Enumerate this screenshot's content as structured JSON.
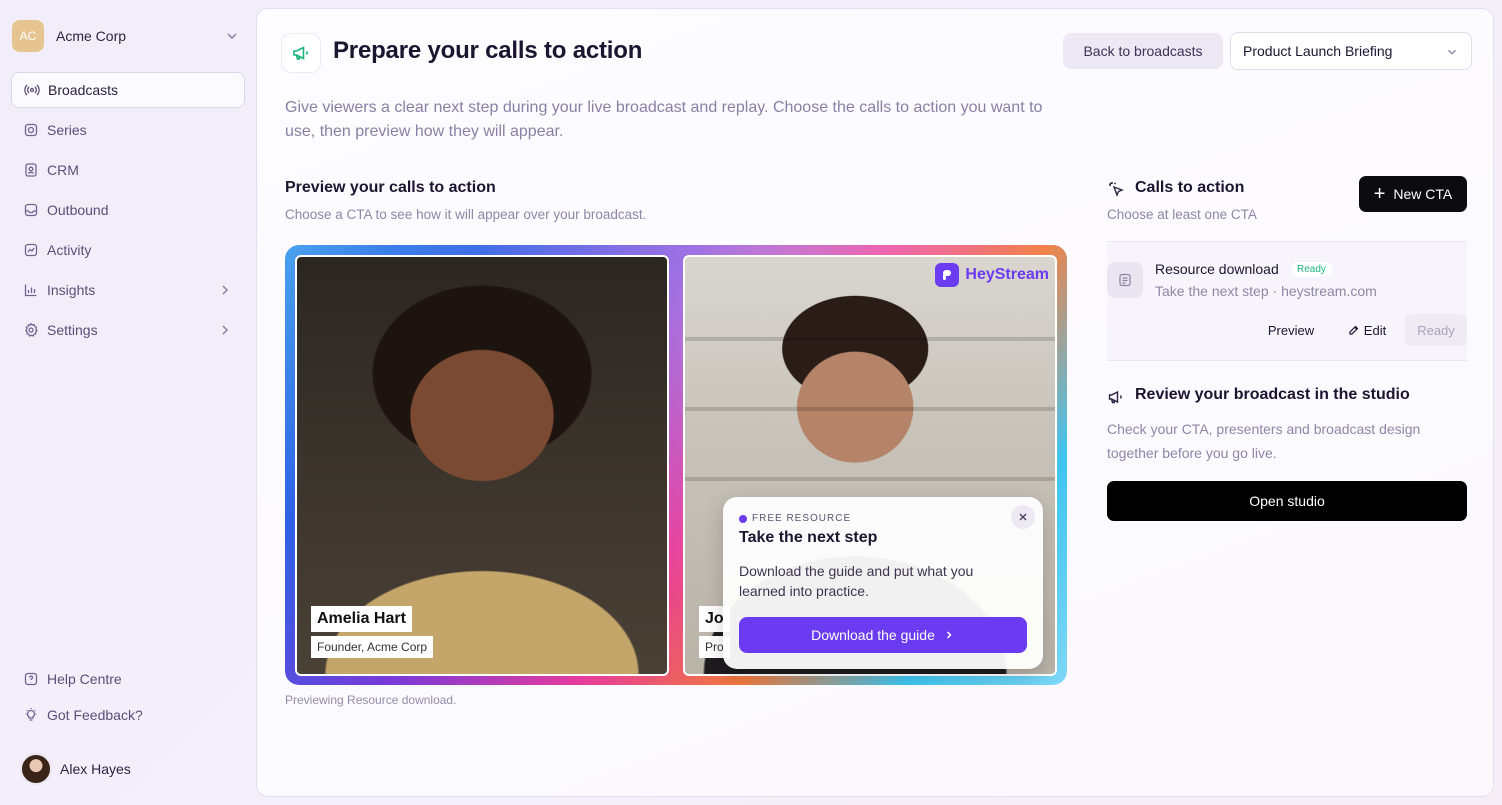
{
  "sidebar": {
    "org": {
      "initials": "AC",
      "name": "Acme Corp"
    },
    "items": [
      {
        "label": "Broadcasts",
        "icon": "broadcast-icon",
        "active": true
      },
      {
        "label": "Series",
        "icon": "series-icon"
      },
      {
        "label": "CRM",
        "icon": "contacts-icon"
      },
      {
        "label": "Outbound",
        "icon": "inbox-icon"
      },
      {
        "label": "Activity",
        "icon": "activity-icon"
      },
      {
        "label": "Insights",
        "icon": "chart-icon",
        "expandable": true
      },
      {
        "label": "Settings",
        "icon": "gear-icon",
        "expandable": true
      }
    ],
    "bottom": [
      {
        "label": "Help Centre",
        "icon": "help-icon"
      },
      {
        "label": "Got Feedback?",
        "icon": "lightbulb-icon"
      }
    ],
    "user": {
      "name": "Alex Hayes"
    }
  },
  "header": {
    "title": "Prepare your calls to action",
    "back_label": "Back to broadcasts",
    "broadcast_select": "Product Launch Briefing",
    "intro": "Give viewers a clear next step during your live broadcast and replay. Choose the calls to action you want to use, then preview how they will appear."
  },
  "preview": {
    "title": "Preview your calls to action",
    "subtitle": "Choose a CTA to see how it will appear over your broadcast.",
    "brand": "HeyStream",
    "presenters": [
      {
        "name": "Amelia Hart",
        "role": "Founder, Acme Corp"
      },
      {
        "name": "Jo",
        "role": "Pro"
      }
    ],
    "cta_card": {
      "kicker": "FREE RESOURCE",
      "title": "Take the next step",
      "body": "Download the guide and put what you learned into practice.",
      "button": "Download the guide"
    },
    "note": "Previewing Resource download."
  },
  "ctas": {
    "title": "Calls to action",
    "subtitle": "Choose at least one CTA",
    "new_label": "New CTA",
    "items": [
      {
        "title": "Resource download",
        "badge": "Ready",
        "subtitle": "Take the next step · heystream.com",
        "preview": "Preview",
        "edit": "Edit",
        "ready": "Ready"
      }
    ]
  },
  "studio": {
    "title": "Review your broadcast in the studio",
    "text": "Check your CTA, presenters and broadcast design together before you go live.",
    "button": "Open studio"
  },
  "colors": {
    "accent": "#6a3bf0",
    "badge_green": "#18b57a",
    "dark_button": "#0b0b10"
  }
}
